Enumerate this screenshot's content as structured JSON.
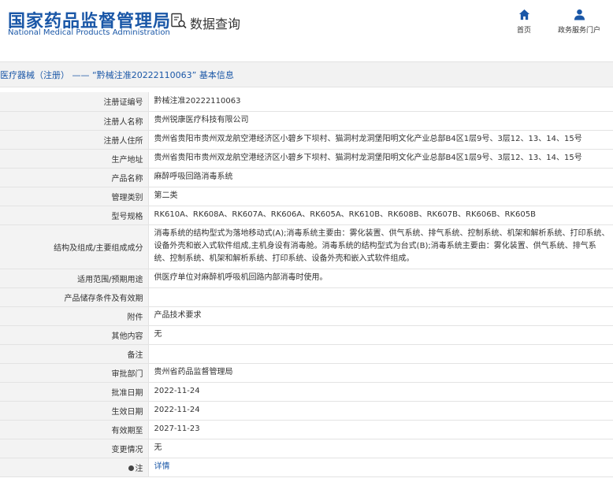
{
  "header": {
    "logo_cn": "国家药品监督管理局",
    "logo_en": "National Medical Products Administration",
    "query_label": "数据查询",
    "nav": [
      {
        "label": "首页",
        "icon": "home-icon"
      },
      {
        "label": "政务服务门户",
        "icon": "user-icon"
      }
    ]
  },
  "breadcrumb": "医疗器械（注册） —— “黔械注准20222110063” 基本信息",
  "colors": {
    "brand": "#1a57a7",
    "label_bg": "#f3f3f3",
    "border": "#e3e3e3"
  },
  "rows": [
    {
      "label": "注册证编号",
      "value": "黔械注准20222110063"
    },
    {
      "label": "注册人名称",
      "value": "贵州锐康医疗科技有限公司"
    },
    {
      "label": "注册人住所",
      "value": "贵州省贵阳市贵州双龙航空港经济区小碧乡下坝村、猫洞村龙洞堡阳明文化产业总部B4区1层9号、3层12、13、14、15号"
    },
    {
      "label": "生产地址",
      "value": "贵州省贵阳市贵州双龙航空港经济区小碧乡下坝村、猫洞村龙洞堡阳明文化产业总部B4区1层9号、3层12、13、14、15号"
    },
    {
      "label": "产品名称",
      "value": "麻醉呼吸回路消毒系统"
    },
    {
      "label": "管理类别",
      "value": "第二类"
    },
    {
      "label": "型号规格",
      "value": "RK610A、RK608A、RK607A、RK606A、RK605A、RK610B、RK608B、RK607B、RK606B、RK605B"
    },
    {
      "label": "结构及组成/主要组成成分",
      "value": "消毒系统的结构型式为落地移动式(A);消毒系统主要由：雾化装置、供气系统、排气系统、控制系统、机架和解析系统、打印系统、设备外壳和嵌入式软件组成,主机身设有消毒舱。消毒系统的结构型式为台式(B);消毒系统主要由：雾化装置、供气系统、排气系统、控制系统、机架和解析系统、打印系统、设备外壳和嵌入式软件组成。"
    },
    {
      "label": "适用范围/预期用途",
      "value": "供医疗单位对麻醉机呼吸机回路内部消毒时使用。"
    },
    {
      "label": "产品储存条件及有效期",
      "value": ""
    },
    {
      "label": "附件",
      "value": "产品技术要求"
    },
    {
      "label": "其他内容",
      "value": "无"
    },
    {
      "label": "备注",
      "value": ""
    },
    {
      "label": "审批部门",
      "value": "贵州省药品监督管理局"
    },
    {
      "label": "批准日期",
      "value": "2022-11-24"
    },
    {
      "label": "生效日期",
      "value": "2022-11-24"
    },
    {
      "label": "有效期至",
      "value": "2027-11-23"
    },
    {
      "label": "变更情况",
      "value": "无"
    }
  ],
  "note_row": {
    "label": "注",
    "link": "详情",
    "icon": "note-icon"
  }
}
